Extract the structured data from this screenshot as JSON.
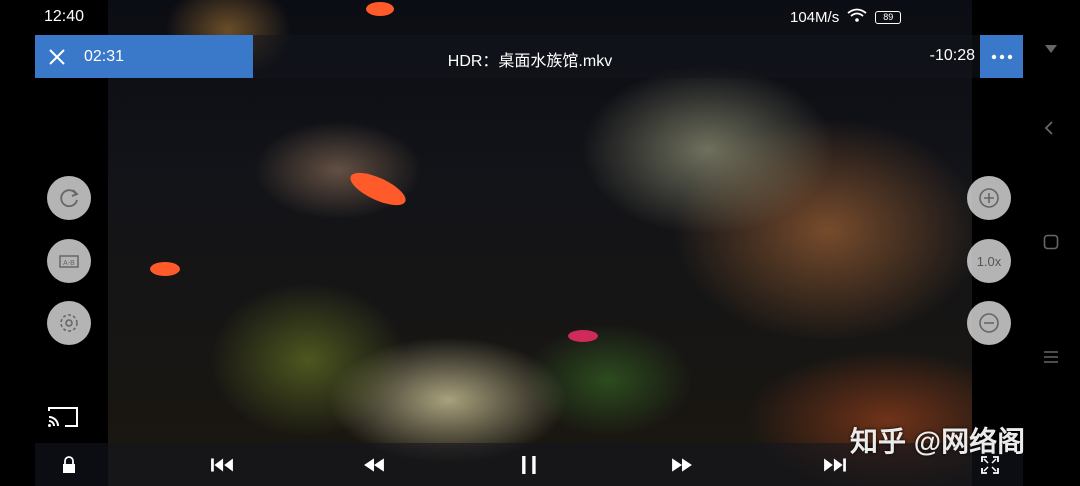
{
  "status_bar": {
    "time": "12:40",
    "network_speed": "104M/s",
    "battery": "89"
  },
  "player": {
    "elapsed": "02:31",
    "title": "HDR：桌面水族馆.mkv",
    "remaining": "-10:28",
    "speed": "1.0x"
  },
  "side_controls_left": [
    "rotate-icon",
    "ab-repeat-icon",
    "settings-icon"
  ],
  "side_controls_right": [
    "zoom-in-icon",
    "speed",
    "zoom-out-icon"
  ],
  "bottom_controls": [
    "lock-icon",
    "skip-previous-icon",
    "rewind-icon",
    "pause-icon",
    "fast-forward-icon",
    "skip-next-icon",
    "fullscreen-icon"
  ],
  "watermark": "知乎 @网络阁",
  "colors": {
    "accent": "#3a78c9",
    "button_bg": "#dcdcdc"
  }
}
